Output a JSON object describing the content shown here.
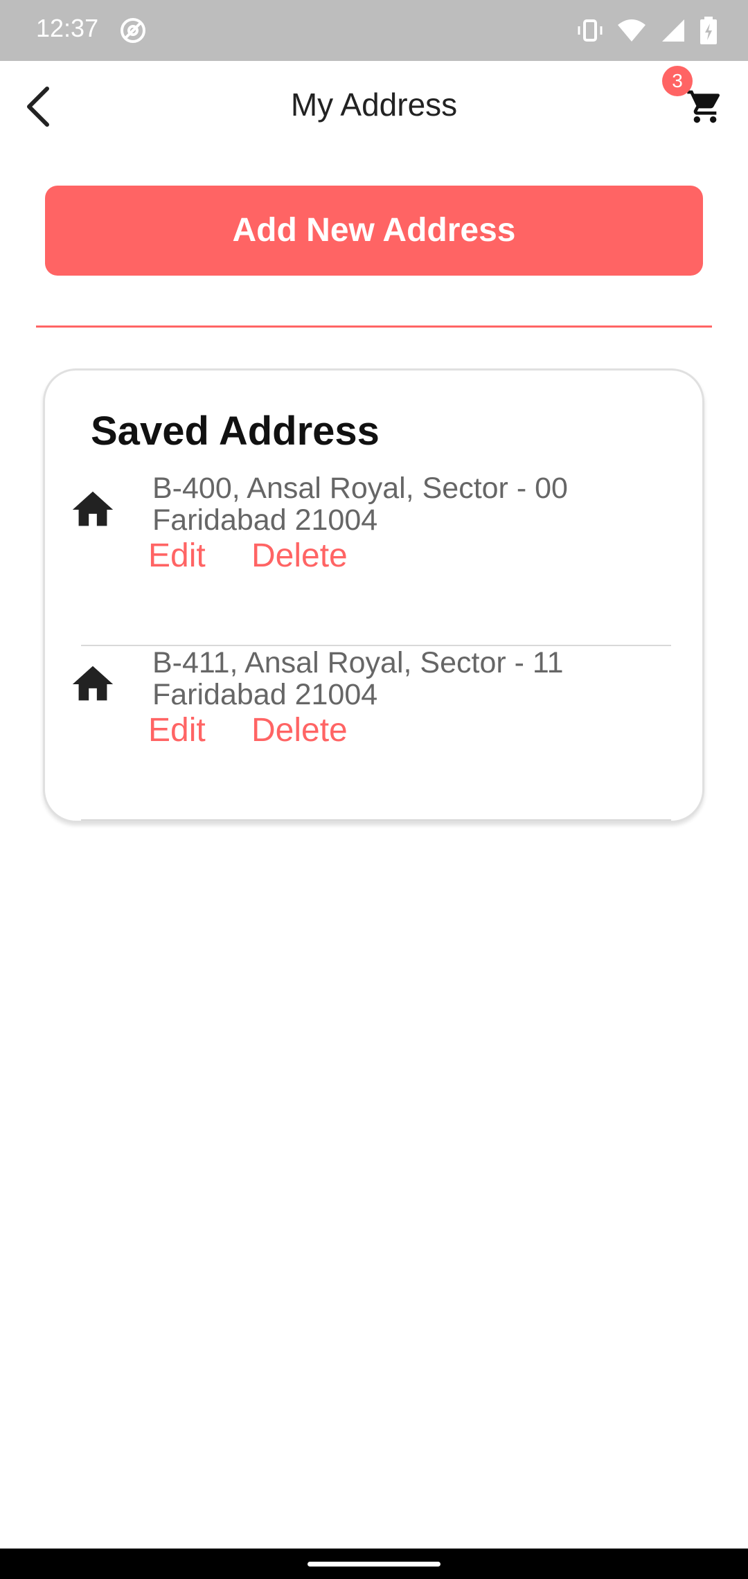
{
  "status_bar": {
    "time": "12:37",
    "icons": [
      "at-sign-icon",
      "vibrate-icon",
      "wifi-icon",
      "signal-icon",
      "battery-charging-icon"
    ]
  },
  "app_bar": {
    "title": "My Address",
    "back_icon": "chevron-left-icon",
    "cart_icon": "shopping-cart-icon",
    "cart_count": "3"
  },
  "actions": {
    "add_new_label": "Add New Address"
  },
  "saved": {
    "title": "Saved Address",
    "addresses": [
      {
        "icon": "home-icon",
        "line1": "B-400, Ansal Royal, Sector - 00",
        "line2": "Faridabad 21004",
        "edit_label": "Edit",
        "delete_label": "Delete"
      },
      {
        "icon": "home-icon",
        "line1": "B-411, Ansal Royal, Sector - 11",
        "line2": "Faridabad 21004",
        "edit_label": "Edit",
        "delete_label": "Delete"
      }
    ]
  },
  "colors": {
    "accent": "#ff6464",
    "status_bar": "#bdbdbd",
    "address_text": "#666666"
  }
}
